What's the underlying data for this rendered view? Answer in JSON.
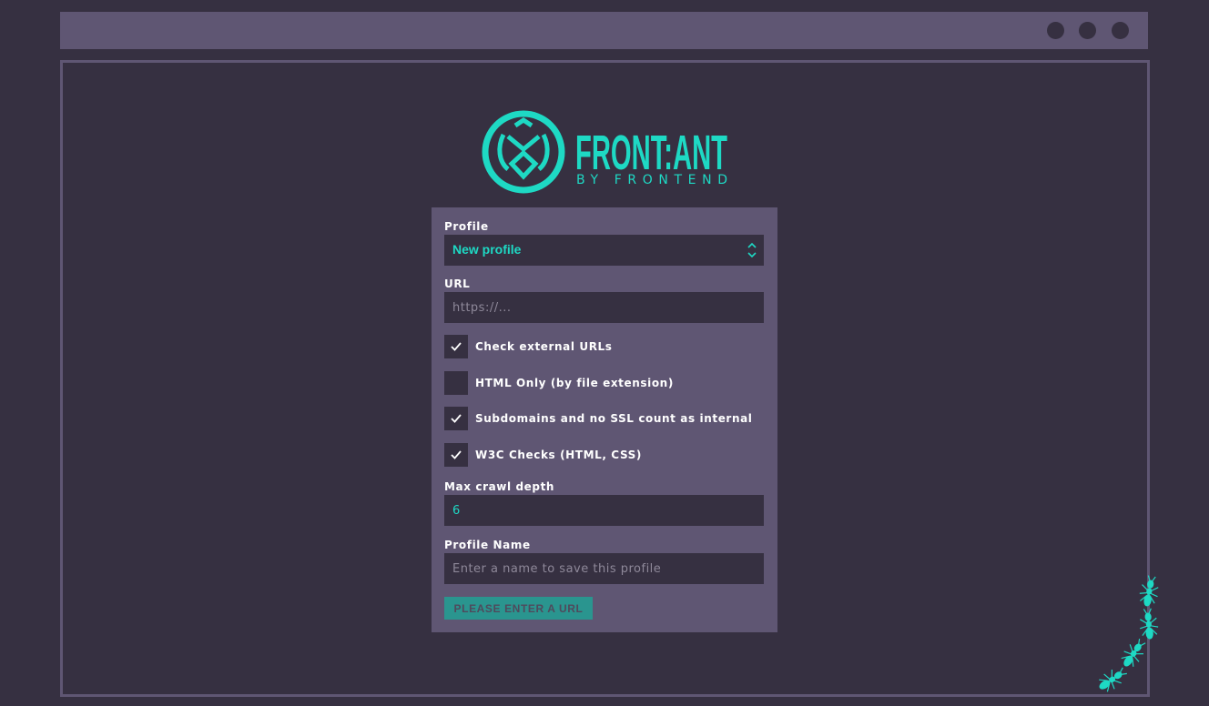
{
  "brand": {
    "name": "FRONT:ANT",
    "tagline": "BY FRONTEND",
    "accent_color": "#1ed9c4"
  },
  "window": {
    "controls": [
      "window-dot",
      "window-dot",
      "window-dot"
    ]
  },
  "form": {
    "profile": {
      "label": "Profile",
      "selected": "New profile"
    },
    "url": {
      "label": "URL",
      "placeholder": "https://..."
    },
    "checkboxes": [
      {
        "label": "Check external URLs",
        "checked": true
      },
      {
        "label": "HTML Only (by file extension)",
        "checked": false
      },
      {
        "label": "Subdomains and no SSL count as internal",
        "checked": true
      },
      {
        "label": "W3C Checks (HTML, CSS)",
        "checked": true
      }
    ],
    "max_depth": {
      "label": "Max crawl depth",
      "value": "6"
    },
    "profile_name": {
      "label": "Profile Name",
      "placeholder": "Enter a name to save this profile"
    },
    "submit_label": "PLEASE ENTER A URL"
  },
  "colors": {
    "background": "#363041",
    "panel": "#5f5673",
    "accent": "#1ed9c4",
    "button": "#2a958f"
  }
}
